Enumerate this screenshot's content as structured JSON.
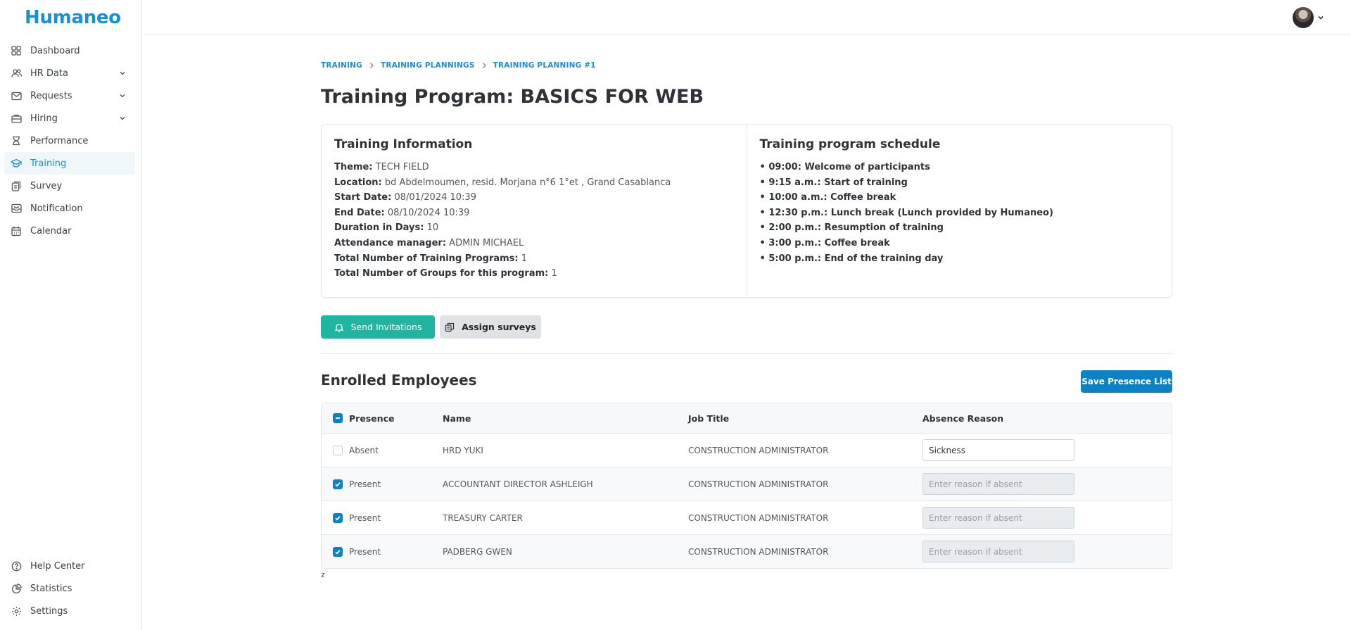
{
  "app": {
    "logo": "Humaneo"
  },
  "sidebar": {
    "items": [
      {
        "label": "Dashboard",
        "icon": "grid-icon",
        "expandable": false,
        "active": false
      },
      {
        "label": "HR Data",
        "icon": "users-icon",
        "expandable": true,
        "active": false
      },
      {
        "label": "Requests",
        "icon": "mail-icon",
        "expandable": true,
        "active": false
      },
      {
        "label": "Hiring",
        "icon": "briefcase-icon",
        "expandable": true,
        "active": false
      },
      {
        "label": "Performance",
        "icon": "trophy-icon",
        "expandable": false,
        "active": false
      },
      {
        "label": "Training",
        "icon": "graduation-cap-icon",
        "expandable": false,
        "active": true
      },
      {
        "label": "Survey",
        "icon": "clipboard-icon",
        "expandable": false,
        "active": false
      },
      {
        "label": "Notification",
        "icon": "inbox-icon",
        "expandable": false,
        "active": false
      },
      {
        "label": "Calendar",
        "icon": "calendar-icon",
        "expandable": false,
        "active": false
      }
    ],
    "bottom_items": [
      {
        "label": "Help Center",
        "icon": "help-circle-icon"
      },
      {
        "label": "Statistics",
        "icon": "pie-chart-icon"
      },
      {
        "label": "Settings",
        "icon": "gear-icon"
      }
    ]
  },
  "breadcrumb": {
    "items": [
      "TRAINING",
      "TRAINING PLANNINGS",
      "TRAINING PLANNING #1"
    ]
  },
  "page": {
    "title": "Training Program: BASICS FOR WEB"
  },
  "training_info": {
    "title": "Training Information",
    "fields": [
      {
        "label": "Theme:",
        "value": "TECH FIELD"
      },
      {
        "label": "Location:",
        "value": "bd Abdelmoumen, resid. Morjana n°6 1°et , Grand Casablanca"
      },
      {
        "label": "Start Date:",
        "value": "08/01/2024 10:39"
      },
      {
        "label": "End Date:",
        "value": "08/10/2024 10:39"
      },
      {
        "label": "Duration in Days:",
        "value": "10"
      },
      {
        "label": "Attendance manager:",
        "value": "ADMIN MICHAEL"
      },
      {
        "label": "Total Number of Training Programs:",
        "value": "1"
      },
      {
        "label": "Total Number of Groups for this program:",
        "value": "1"
      }
    ]
  },
  "schedule": {
    "title": "Training program schedule",
    "items": [
      "• 09:00: Welcome of participants",
      "• 9:15 a.m.: Start of training",
      "• 10:00 a.m.: Coffee break",
      "• 12:30 p.m.: Lunch break (Lunch provided by Humaneo)",
      "• 2:00 p.m.: Resumption of training",
      "• 3:00 p.m.: Coffee break",
      "• 5:00 p.m.: End of the training day"
    ]
  },
  "actions": {
    "send_invitations": "Send Invitations",
    "assign_surveys": "Assign surveys",
    "save_presence": "Save Presence List"
  },
  "enrolled": {
    "title": "Enrolled Employees",
    "columns": {
      "presence": "Presence",
      "name": "Name",
      "job_title": "Job Title",
      "absence_reason": "Absence Reason"
    },
    "rows": [
      {
        "presence": "Absent",
        "checked": false,
        "name": "HRD YUKI",
        "job_title": "CONSTRUCTION ADMINISTRATOR",
        "reason": "Sickness",
        "placeholder": ""
      },
      {
        "presence": "Present",
        "checked": true,
        "name": "ACCOUNTANT DIRECTOR ASHLEIGH",
        "job_title": "CONSTRUCTION ADMINISTRATOR",
        "reason": "",
        "placeholder": "Enter reason if absent"
      },
      {
        "presence": "Present",
        "checked": true,
        "name": "TREASURY CARTER",
        "job_title": "CONSTRUCTION ADMINISTRATOR",
        "reason": "",
        "placeholder": "Enter reason if absent"
      },
      {
        "presence": "Present",
        "checked": true,
        "name": "PADBERG GWEN",
        "job_title": "CONSTRUCTION ADMINISTRATOR",
        "reason": "",
        "placeholder": "Enter reason if absent"
      }
    ]
  },
  "footnote": "z",
  "colors": {
    "brand": "#1a8fd1",
    "teal": "#1fb5a1",
    "primary": "#0b82c6"
  }
}
